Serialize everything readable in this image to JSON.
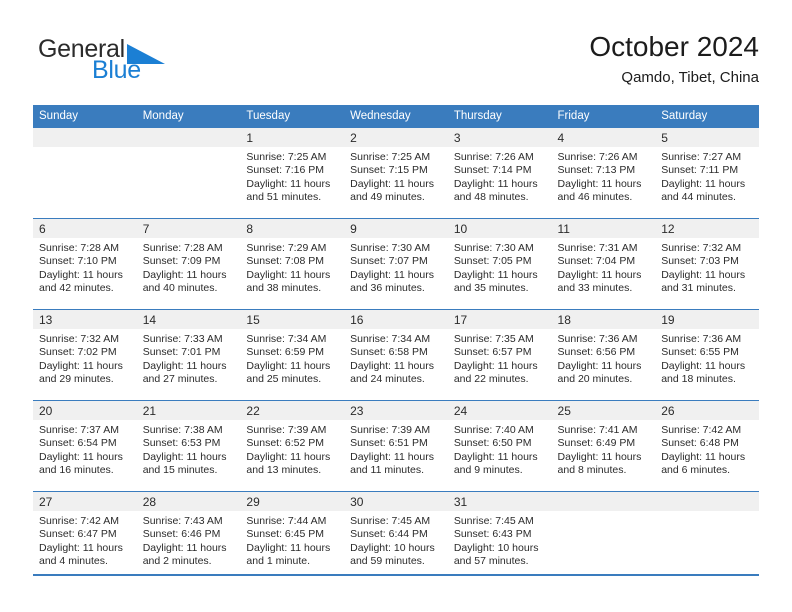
{
  "brand": {
    "word_top": "General",
    "word_bottom": "Blue",
    "triangle_color": "#1b7fd4",
    "text_color": "#2b2b2b"
  },
  "header": {
    "title": "October 2024",
    "subtitle": "Qamdo, Tibet, China"
  },
  "theme": {
    "header_blue": "#3a7cbe",
    "cell_head_gray": "#f0f0f0",
    "text": "#2b2b2b"
  },
  "weekdays": [
    "Sunday",
    "Monday",
    "Tuesday",
    "Wednesday",
    "Thursday",
    "Friday",
    "Saturday"
  ],
  "labels": {
    "sunrise_prefix": "Sunrise:",
    "sunset_prefix": "Sunset:",
    "daylight_prefix": "Daylight:"
  },
  "weeks": [
    [
      {
        "day": "",
        "line1": "",
        "line2": "",
        "line3": "",
        "line4": ""
      },
      {
        "day": "",
        "line1": "",
        "line2": "",
        "line3": "",
        "line4": ""
      },
      {
        "day": "1",
        "line1": "Sunrise: 7:25 AM",
        "line2": "Sunset: 7:16 PM",
        "line3": "Daylight: 11 hours",
        "line4": "and 51 minutes."
      },
      {
        "day": "2",
        "line1": "Sunrise: 7:25 AM",
        "line2": "Sunset: 7:15 PM",
        "line3": "Daylight: 11 hours",
        "line4": "and 49 minutes."
      },
      {
        "day": "3",
        "line1": "Sunrise: 7:26 AM",
        "line2": "Sunset: 7:14 PM",
        "line3": "Daylight: 11 hours",
        "line4": "and 48 minutes."
      },
      {
        "day": "4",
        "line1": "Sunrise: 7:26 AM",
        "line2": "Sunset: 7:13 PM",
        "line3": "Daylight: 11 hours",
        "line4": "and 46 minutes."
      },
      {
        "day": "5",
        "line1": "Sunrise: 7:27 AM",
        "line2": "Sunset: 7:11 PM",
        "line3": "Daylight: 11 hours",
        "line4": "and 44 minutes."
      }
    ],
    [
      {
        "day": "6",
        "line1": "Sunrise: 7:28 AM",
        "line2": "Sunset: 7:10 PM",
        "line3": "Daylight: 11 hours",
        "line4": "and 42 minutes."
      },
      {
        "day": "7",
        "line1": "Sunrise: 7:28 AM",
        "line2": "Sunset: 7:09 PM",
        "line3": "Daylight: 11 hours",
        "line4": "and 40 minutes."
      },
      {
        "day": "8",
        "line1": "Sunrise: 7:29 AM",
        "line2": "Sunset: 7:08 PM",
        "line3": "Daylight: 11 hours",
        "line4": "and 38 minutes."
      },
      {
        "day": "9",
        "line1": "Sunrise: 7:30 AM",
        "line2": "Sunset: 7:07 PM",
        "line3": "Daylight: 11 hours",
        "line4": "and 36 minutes."
      },
      {
        "day": "10",
        "line1": "Sunrise: 7:30 AM",
        "line2": "Sunset: 7:05 PM",
        "line3": "Daylight: 11 hours",
        "line4": "and 35 minutes."
      },
      {
        "day": "11",
        "line1": "Sunrise: 7:31 AM",
        "line2": "Sunset: 7:04 PM",
        "line3": "Daylight: 11 hours",
        "line4": "and 33 minutes."
      },
      {
        "day": "12",
        "line1": "Sunrise: 7:32 AM",
        "line2": "Sunset: 7:03 PM",
        "line3": "Daylight: 11 hours",
        "line4": "and 31 minutes."
      }
    ],
    [
      {
        "day": "13",
        "line1": "Sunrise: 7:32 AM",
        "line2": "Sunset: 7:02 PM",
        "line3": "Daylight: 11 hours",
        "line4": "and 29 minutes."
      },
      {
        "day": "14",
        "line1": "Sunrise: 7:33 AM",
        "line2": "Sunset: 7:01 PM",
        "line3": "Daylight: 11 hours",
        "line4": "and 27 minutes."
      },
      {
        "day": "15",
        "line1": "Sunrise: 7:34 AM",
        "line2": "Sunset: 6:59 PM",
        "line3": "Daylight: 11 hours",
        "line4": "and 25 minutes."
      },
      {
        "day": "16",
        "line1": "Sunrise: 7:34 AM",
        "line2": "Sunset: 6:58 PM",
        "line3": "Daylight: 11 hours",
        "line4": "and 24 minutes."
      },
      {
        "day": "17",
        "line1": "Sunrise: 7:35 AM",
        "line2": "Sunset: 6:57 PM",
        "line3": "Daylight: 11 hours",
        "line4": "and 22 minutes."
      },
      {
        "day": "18",
        "line1": "Sunrise: 7:36 AM",
        "line2": "Sunset: 6:56 PM",
        "line3": "Daylight: 11 hours",
        "line4": "and 20 minutes."
      },
      {
        "day": "19",
        "line1": "Sunrise: 7:36 AM",
        "line2": "Sunset: 6:55 PM",
        "line3": "Daylight: 11 hours",
        "line4": "and 18 minutes."
      }
    ],
    [
      {
        "day": "20",
        "line1": "Sunrise: 7:37 AM",
        "line2": "Sunset: 6:54 PM",
        "line3": "Daylight: 11 hours",
        "line4": "and 16 minutes."
      },
      {
        "day": "21",
        "line1": "Sunrise: 7:38 AM",
        "line2": "Sunset: 6:53 PM",
        "line3": "Daylight: 11 hours",
        "line4": "and 15 minutes."
      },
      {
        "day": "22",
        "line1": "Sunrise: 7:39 AM",
        "line2": "Sunset: 6:52 PM",
        "line3": "Daylight: 11 hours",
        "line4": "and 13 minutes."
      },
      {
        "day": "23",
        "line1": "Sunrise: 7:39 AM",
        "line2": "Sunset: 6:51 PM",
        "line3": "Daylight: 11 hours",
        "line4": "and 11 minutes."
      },
      {
        "day": "24",
        "line1": "Sunrise: 7:40 AM",
        "line2": "Sunset: 6:50 PM",
        "line3": "Daylight: 11 hours",
        "line4": "and 9 minutes."
      },
      {
        "day": "25",
        "line1": "Sunrise: 7:41 AM",
        "line2": "Sunset: 6:49 PM",
        "line3": "Daylight: 11 hours",
        "line4": "and 8 minutes."
      },
      {
        "day": "26",
        "line1": "Sunrise: 7:42 AM",
        "line2": "Sunset: 6:48 PM",
        "line3": "Daylight: 11 hours",
        "line4": "and 6 minutes."
      }
    ],
    [
      {
        "day": "27",
        "line1": "Sunrise: 7:42 AM",
        "line2": "Sunset: 6:47 PM",
        "line3": "Daylight: 11 hours",
        "line4": "and 4 minutes."
      },
      {
        "day": "28",
        "line1": "Sunrise: 7:43 AM",
        "line2": "Sunset: 6:46 PM",
        "line3": "Daylight: 11 hours",
        "line4": "and 2 minutes."
      },
      {
        "day": "29",
        "line1": "Sunrise: 7:44 AM",
        "line2": "Sunset: 6:45 PM",
        "line3": "Daylight: 11 hours",
        "line4": "and 1 minute."
      },
      {
        "day": "30",
        "line1": "Sunrise: 7:45 AM",
        "line2": "Sunset: 6:44 PM",
        "line3": "Daylight: 10 hours",
        "line4": "and 59 minutes."
      },
      {
        "day": "31",
        "line1": "Sunrise: 7:45 AM",
        "line2": "Sunset: 6:43 PM",
        "line3": "Daylight: 10 hours",
        "line4": "and 57 minutes."
      },
      {
        "day": "",
        "line1": "",
        "line2": "",
        "line3": "",
        "line4": ""
      },
      {
        "day": "",
        "line1": "",
        "line2": "",
        "line3": "",
        "line4": ""
      }
    ]
  ]
}
